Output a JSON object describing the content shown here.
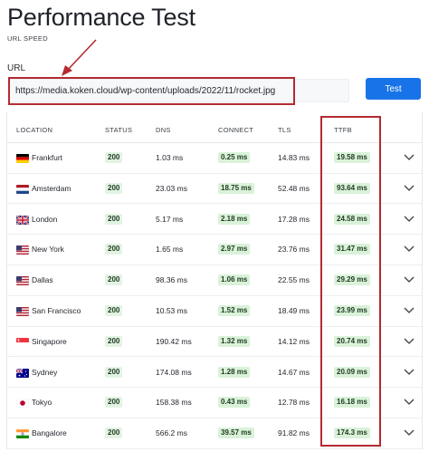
{
  "page": {
    "title": "Performance Test",
    "subtitle": "URL SPEED",
    "url_label": "URL",
    "url_value": "https://media.koken.cloud/wp-content/uploads/2022/11/rocket.jpg",
    "test_label": "Test"
  },
  "colors": {
    "accent": "#1873e8",
    "highlight_red": "#b52a31",
    "badge_green": "#d9f2d9"
  },
  "table": {
    "headers": {
      "location": "LOCATION",
      "status": "STATUS",
      "dns": "DNS",
      "connect": "CONNECT",
      "tls": "TLS",
      "ttfb": "TTFB"
    },
    "rows": [
      {
        "flag": "germany-flag-icon",
        "location": "Frankfurt",
        "status": "200",
        "dns": "1.03 ms",
        "connect": "0.25 ms",
        "tls": "14.83 ms",
        "ttfb": "19.58 ms"
      },
      {
        "flag": "netherlands-flag-icon",
        "location": "Amsterdam",
        "status": "200",
        "dns": "23.03 ms",
        "connect": "18.75 ms",
        "tls": "52.48 ms",
        "ttfb": "93.64 ms"
      },
      {
        "flag": "uk-flag-icon",
        "location": "London",
        "status": "200",
        "dns": "5.17 ms",
        "connect": "2.18 ms",
        "tls": "17.28 ms",
        "ttfb": "24.58 ms"
      },
      {
        "flag": "us-flag-icon",
        "location": "New York",
        "status": "200",
        "dns": "1.65 ms",
        "connect": "2.97 ms",
        "tls": "23.76 ms",
        "ttfb": "31.47 ms"
      },
      {
        "flag": "us-flag-icon",
        "location": "Dallas",
        "status": "200",
        "dns": "98.36 ms",
        "connect": "1.06 ms",
        "tls": "22.55 ms",
        "ttfb": "29.29 ms"
      },
      {
        "flag": "us-flag-icon",
        "location": "San Francisco",
        "status": "200",
        "dns": "10.53 ms",
        "connect": "1.52 ms",
        "tls": "18.49 ms",
        "ttfb": "23.99 ms"
      },
      {
        "flag": "singapore-flag-icon",
        "location": "Singapore",
        "status": "200",
        "dns": "190.42 ms",
        "connect": "1.32 ms",
        "tls": "14.12 ms",
        "ttfb": "20.74 ms"
      },
      {
        "flag": "australia-flag-icon",
        "location": "Sydney",
        "status": "200",
        "dns": "174.08 ms",
        "connect": "1.28 ms",
        "tls": "14.67 ms",
        "ttfb": "20.09 ms"
      },
      {
        "flag": "japan-flag-icon",
        "location": "Tokyo",
        "status": "200",
        "dns": "158.38 ms",
        "connect": "0.43 ms",
        "tls": "12.78 ms",
        "ttfb": "16.18 ms"
      },
      {
        "flag": "india-flag-icon",
        "location": "Bangalore",
        "status": "200",
        "dns": "566.2 ms",
        "connect": "39.57 ms",
        "tls": "91.82 ms",
        "ttfb": "174.3 ms"
      }
    ]
  }
}
